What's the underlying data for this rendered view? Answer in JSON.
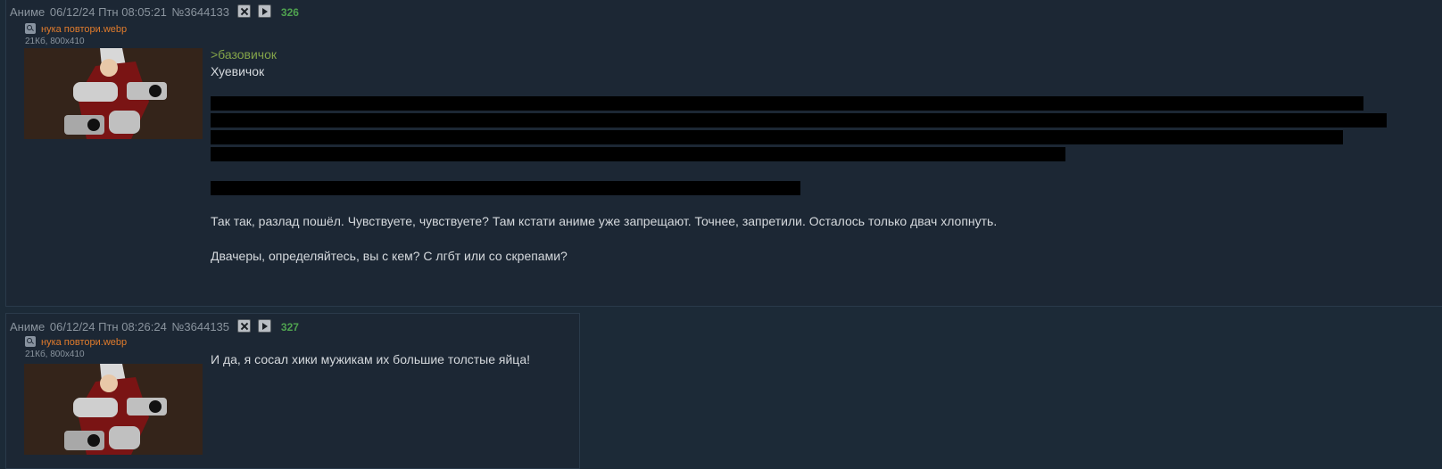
{
  "posts": [
    {
      "name": "Аниме",
      "date": "06/12/24 Птн 08:05:21",
      "num": "№3644133",
      "count": "326",
      "file_name": "нука повтори.webp",
      "file_info": "21Кб, 800x410",
      "greentext": ">базовичок",
      "line2": "Хуевичок",
      "para1": "Так так, разлад пошёл. Чувствуете, чувствуете? Там кстати аниме уже запрещают. Точнее, запретили. Осталось только двач хлопнуть.",
      "para2": "Двачеры, определяйтесь, вы с кем? С лгбт или со скрепами?"
    },
    {
      "name": "Аниме",
      "date": "06/12/24 Птн 08:26:24",
      "num": "№3644135",
      "count": "327",
      "file_name": "нука повтори.webp",
      "file_info": "21Кб, 800x410",
      "para1": "И да, я сосал хики мужикам их большие толстые яйца!"
    }
  ],
  "icons": {
    "hide": "close-icon",
    "report": "play-icon",
    "zoom": "search-icon"
  },
  "colors": {
    "background": "#1c2a37",
    "filename": "#e07b2c",
    "greentext": "#83a349",
    "postcount": "#4fa24f"
  }
}
